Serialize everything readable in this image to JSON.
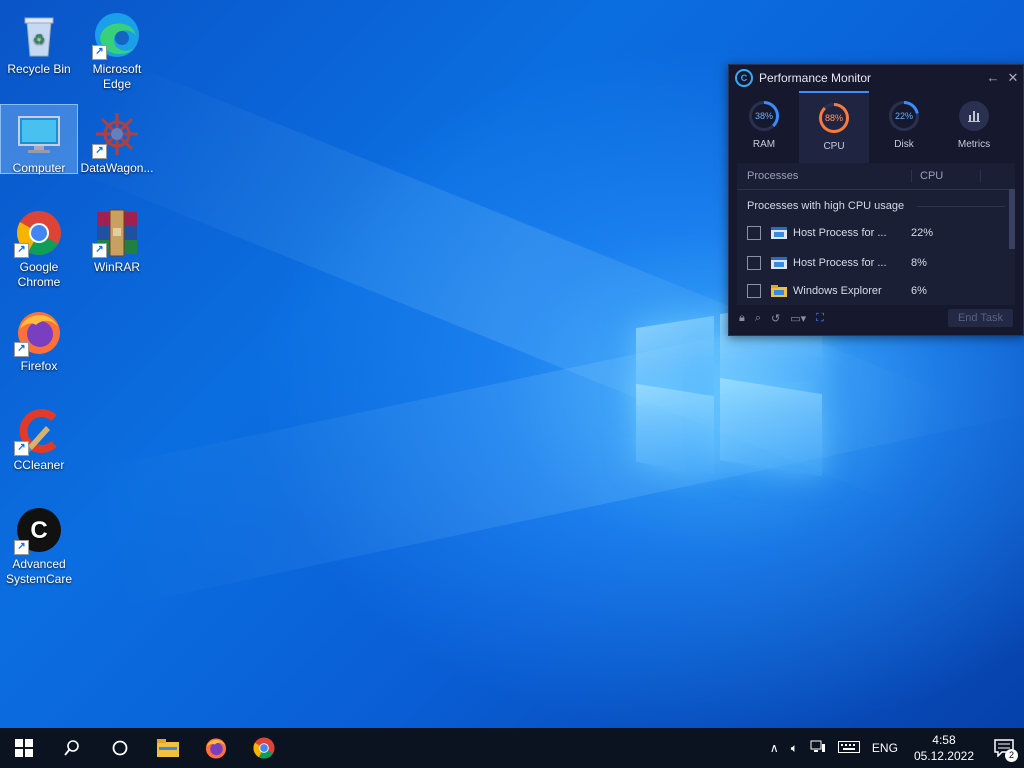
{
  "desktop": {
    "icons": [
      {
        "label": "Recycle Bin"
      },
      {
        "label": "Microsoft Edge"
      },
      {
        "label": "Computer"
      },
      {
        "label": "DataWagon..."
      },
      {
        "label": "Google Chrome"
      },
      {
        "label": "WinRAR"
      },
      {
        "label": "Firefox"
      },
      {
        "label": "CCleaner"
      },
      {
        "label": "Advanced SystemCare"
      }
    ]
  },
  "perf_monitor": {
    "title": "Performance Monitor",
    "tabs": [
      {
        "label": "RAM",
        "value": "38%",
        "level": 0.38,
        "color": "#3a8dff"
      },
      {
        "label": "CPU",
        "value": "88%",
        "level": 0.88,
        "color": "#ff7a3a"
      },
      {
        "label": "Disk",
        "value": "22%",
        "level": 0.22,
        "color": "#3a8dff"
      },
      {
        "label": "Metrics",
        "icon": "bar-chart-icon"
      }
    ],
    "columns": {
      "processes": "Processes",
      "cpu": "CPU"
    },
    "section_title": "Processes with high CPU usage",
    "rows": [
      {
        "name": "Host Process for ...",
        "cpu": "22%"
      },
      {
        "name": "Host Process for ...",
        "cpu": "8%"
      },
      {
        "name": "Windows Explorer",
        "cpu": "6%"
      }
    ],
    "end_task_label": "End Task"
  },
  "taskbar": {
    "language": "ENG",
    "time": "4:58",
    "date": "05.12.2022",
    "notification_count": "2"
  }
}
